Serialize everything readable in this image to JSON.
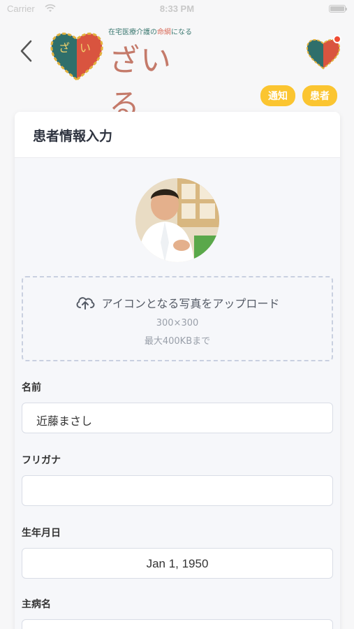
{
  "status_bar": {
    "carrier": "Carrier",
    "time": "8:33 PM"
  },
  "header": {
    "back_icon": "chevron-left-icon",
    "logo_tagline_pre": "在宅医療介護の",
    "logo_tagline_accent": "命綱",
    "logo_tagline_post": "になる",
    "logo_wordmark": "ざいる",
    "has_notification": true,
    "tags": [
      "通知",
      "患者"
    ]
  },
  "card": {
    "title": "患者情報入力",
    "upload": {
      "label": "アイコンとなる写真をアップロード",
      "dimensions": "300×300",
      "max_size": "最大400KBまで",
      "icon": "cloud-upload-icon"
    },
    "fields": {
      "name": {
        "label": "名前",
        "value": "近藤まさし"
      },
      "furigana": {
        "label": "フリガナ",
        "value": ""
      },
      "birthdate": {
        "label": "生年月日",
        "value": "Jan 1, 1950"
      },
      "disease": {
        "label": "主病名",
        "value": ""
      }
    }
  },
  "colors": {
    "accent_yellow": "#fbc531",
    "notification_red": "#ef4b33",
    "logo_teal": "#3d7a72",
    "logo_brown": "#c47a6a"
  }
}
